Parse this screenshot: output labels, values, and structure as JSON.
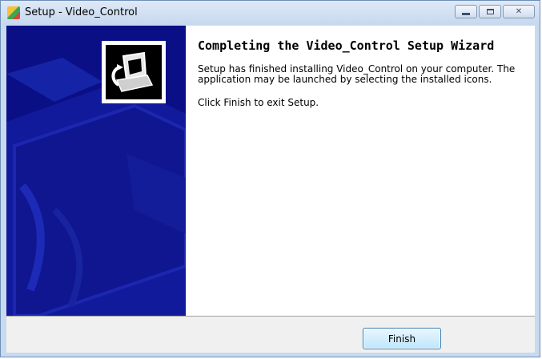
{
  "window": {
    "title": "Setup - Video_Control"
  },
  "wizard": {
    "heading": "Completing the Video_Control Setup Wizard",
    "paragraph1": "Setup has finished installing Video_Control on your computer. The application may be launched by selecting the installed icons.",
    "paragraph2": "Click Finish to exit Setup."
  },
  "footer": {
    "finish_label": "Finish"
  },
  "colors": {
    "side_panel": "#0b0f86",
    "title_bar": "#c6d8ef",
    "button_border": "#3c7fb1"
  },
  "icons": [
    "app-setup-icon",
    "minimize-icon",
    "maximize-icon",
    "close-icon",
    "wizard-computer-icon"
  ]
}
